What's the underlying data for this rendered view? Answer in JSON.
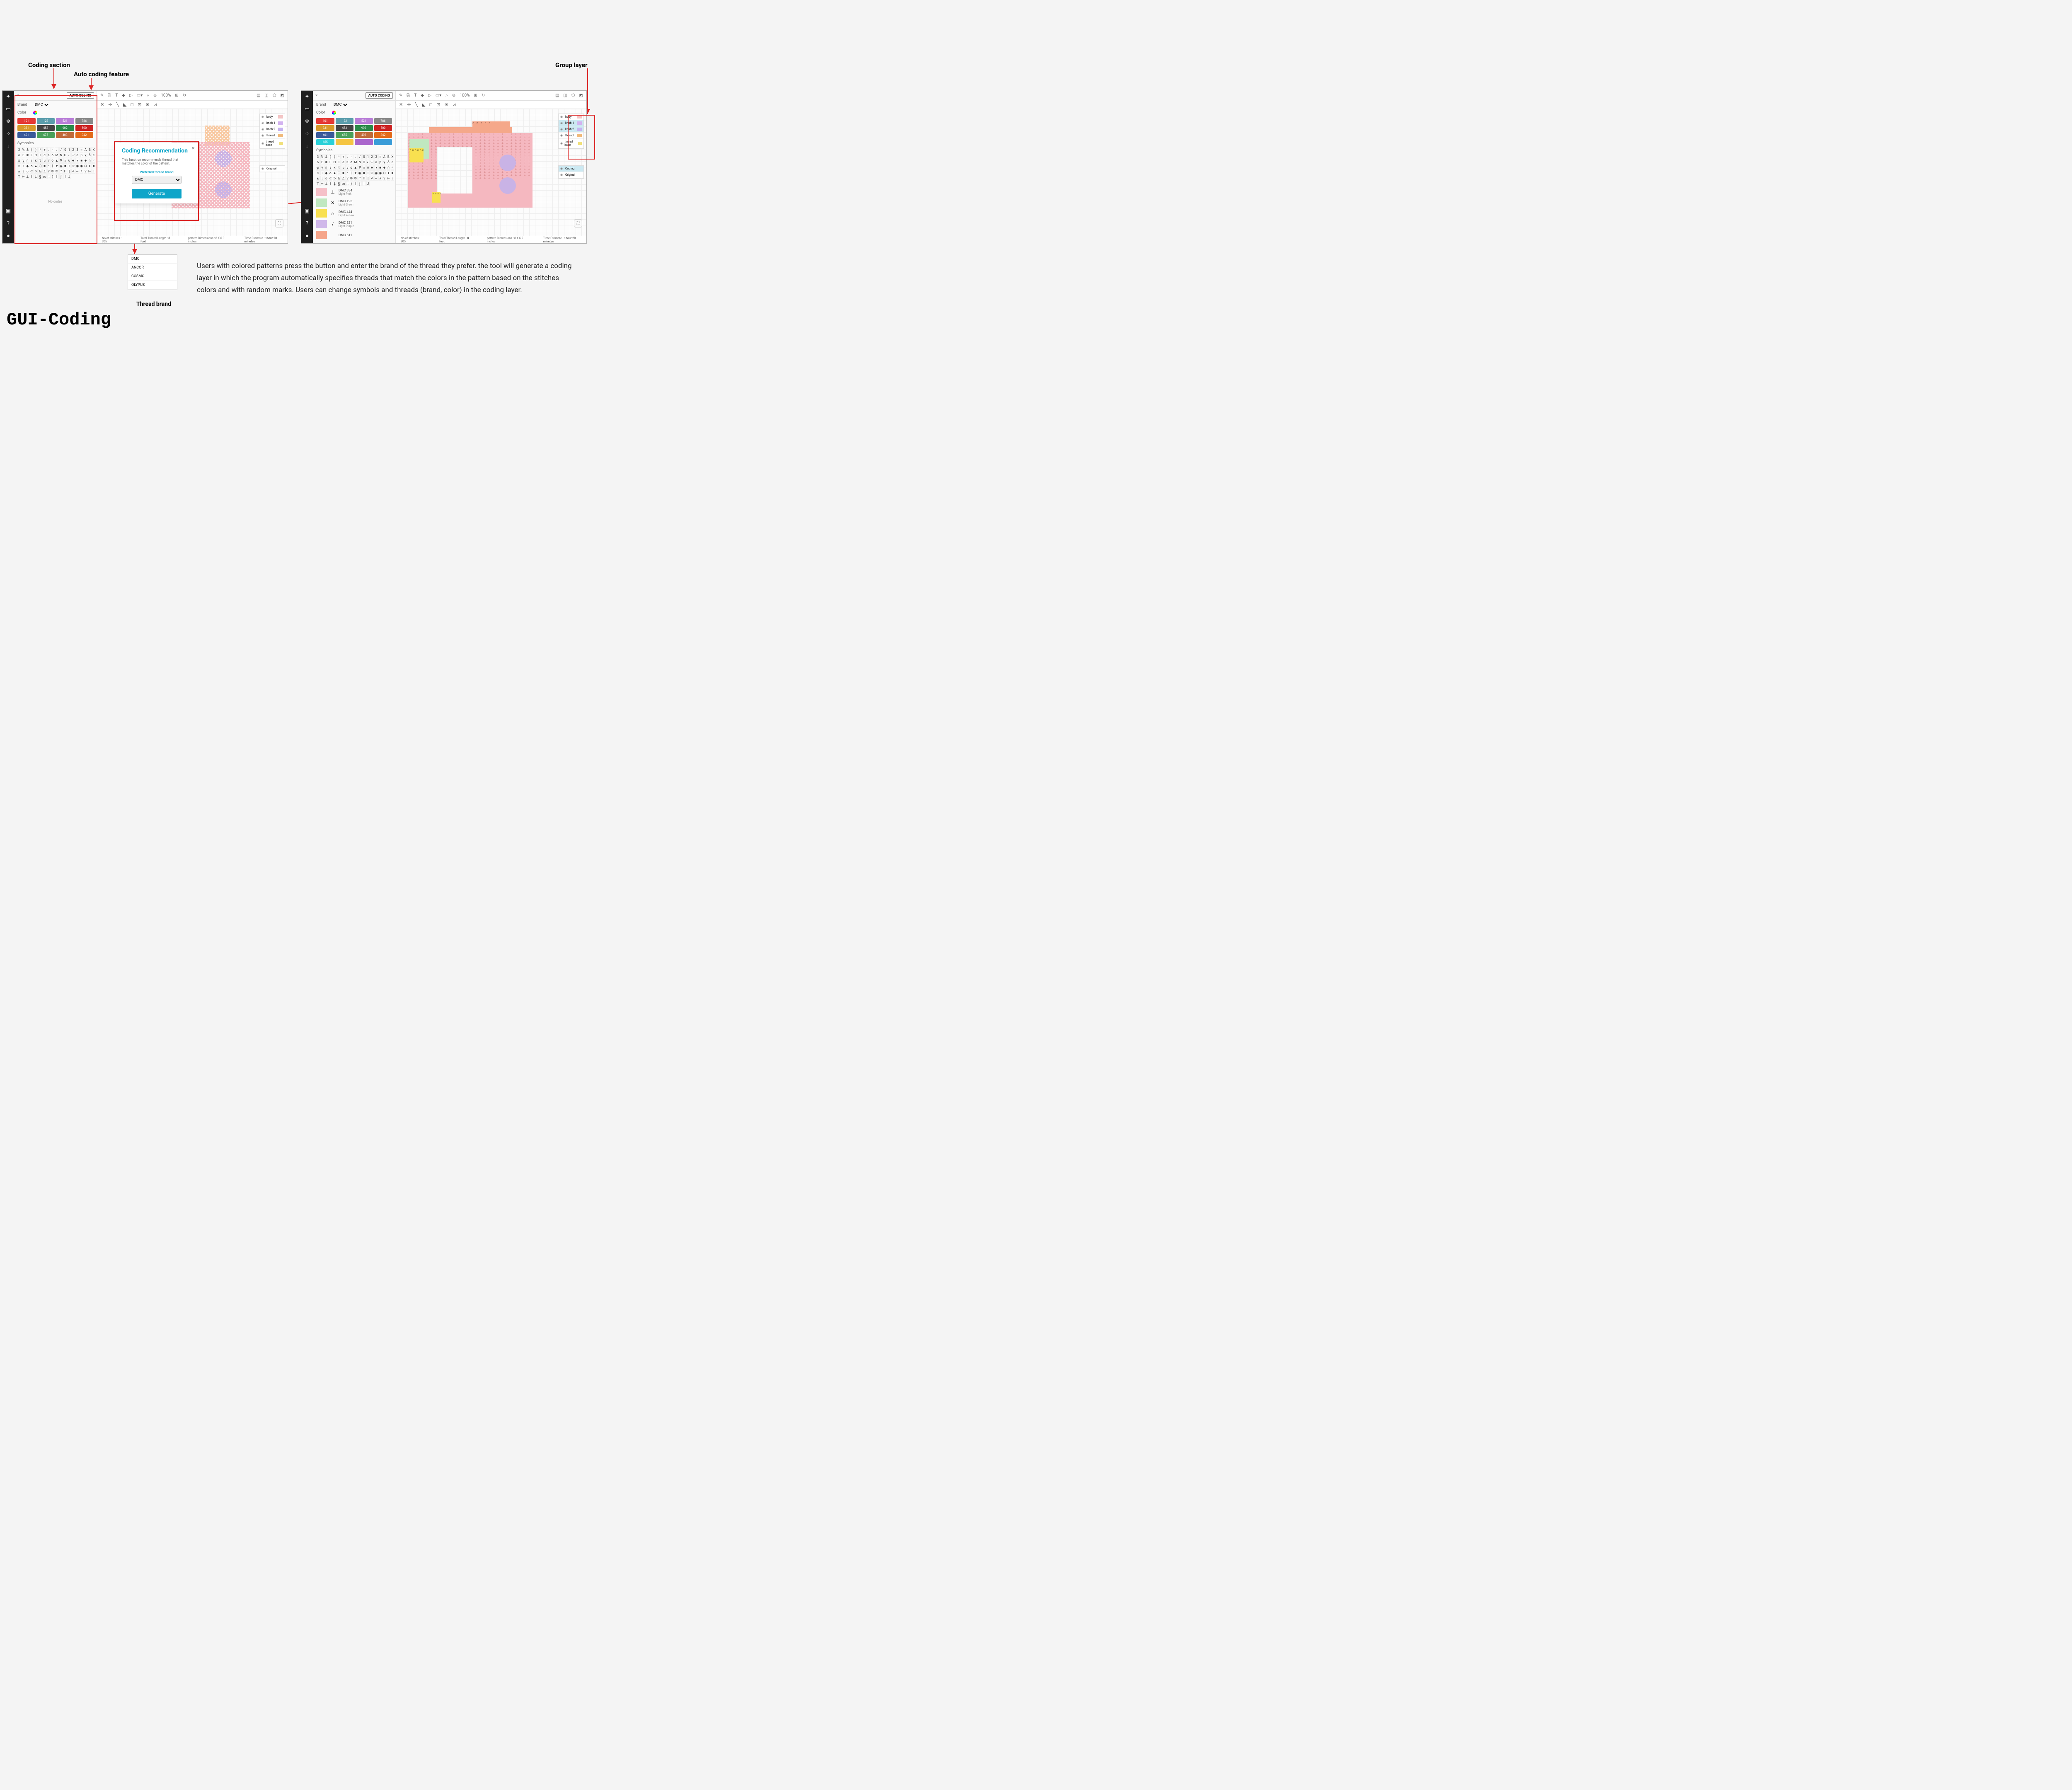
{
  "annotations": {
    "coding_section": "Coding section",
    "auto_coding_feature": "Auto coding feature",
    "group_layer": "Group layer",
    "thread_brand": "Thread brand"
  },
  "sidebar": {
    "auto_coding": "AUTO CODING",
    "brand_label": "Brand",
    "brand_value": "DMC",
    "color_label": "Color",
    "symbols_label": "Symboles",
    "no_codes": "No codes"
  },
  "swatches": [
    {
      "c": "#e53935",
      "t": "101"
    },
    {
      "c": "#5c9ead",
      "t": "122"
    },
    {
      "c": "#b97fd8",
      "t": "521"
    },
    {
      "c": "#888",
      "t": "786"
    },
    {
      "c": "#d89a2a",
      "t": "331"
    },
    {
      "c": "#444",
      "t": "453"
    },
    {
      "c": "#2a8a4a",
      "t": "902"
    },
    {
      "c": "#c22",
      "t": "500"
    },
    {
      "c": "#3b5a9a",
      "t": "401"
    },
    {
      "c": "#4aa05a",
      "t": "675"
    },
    {
      "c": "#c06a3a",
      "t": "403"
    },
    {
      "c": "#e36a1a",
      "t": "342"
    }
  ],
  "extra_swatches": [
    {
      "c": "#2ad0d8",
      "t": "655"
    },
    {
      "c": "#f5c542",
      "t": ""
    },
    {
      "c": "#aa66cc",
      "t": ""
    },
    {
      "c": "#3a9cd8",
      "t": ""
    }
  ],
  "symbols_rows": [
    "3 % & ( ) * + , - . / 0 1 2 3",
    "≡ A B X Δ E Φ Γ H I ϑ K Λ M N O",
    "◐ ♡ α β χ δ ε φ γ η ι κ τ μ ν ο",
    "▲ ∇ ☼ ∪ ♣ ◑ ■ ♣ ☆ ♂ ○ ◦ ◆ ✕ ▲ ⬡",
    "■ • | ♥ ◉ ■ + ☆ ◉ ◉ ⊡ ♦ ■ ▲ ↕",
    "∂ ⊂ ⊃ ∈ ∠ ∨ ® © ™ Π ∫ √ ∼ ∧ ∨",
    "⊢ ↑ ⊤ ⊨ ⊥ † ‡ § ∞ ∴ )  | ƒ |  J",
    ""
  ],
  "toolbar": {
    "zoom": "100%"
  },
  "modal": {
    "title": "Coding Recommendation",
    "desc": "This function recommends thread that matches the color of the pattern.",
    "pref_label": "Preferred thread brand",
    "brand": "DMC",
    "generate": "Generate"
  },
  "brand_options": [
    "DMC",
    "ANCOR",
    "COSMO",
    "OLYPUS"
  ],
  "layers_left": [
    {
      "name": "body",
      "c": "#f4c6c6"
    },
    {
      "name": "knob 1",
      "c": "#d3b3f0"
    },
    {
      "name": "knob 2",
      "c": "#c6b3f0"
    },
    {
      "name": "thread",
      "c": "#f0b97a"
    },
    {
      "name": "thread base",
      "c": "#f0e07a"
    }
  ],
  "layers_right": [
    {
      "name": "body",
      "c": "#f4c6c6"
    },
    {
      "name": "knob 1",
      "c": "#d3b3f0",
      "sel": true
    },
    {
      "name": "knob 2",
      "c": "#c6b3f0",
      "sel": true
    },
    {
      "name": "thread",
      "c": "#f0b97a"
    },
    {
      "name": "thread base",
      "c": "#f0e07a"
    }
  ],
  "layers_extra": [
    {
      "name": "Coding",
      "sel": true
    },
    {
      "name": "Original"
    }
  ],
  "layer_original": "Original",
  "threads": [
    {
      "c": "#f5c0c8",
      "sym": "⊥",
      "code": "DMC   334",
      "name": "Light Pink"
    },
    {
      "c": "#c0e8c0",
      "sym": "✕",
      "code": "DMC   125",
      "name": "Light Green"
    },
    {
      "c": "#f8e050",
      "sym": "∩",
      "code": "DMC   444",
      "name": "Light Yellow"
    },
    {
      "c": "#d0b8ea",
      "sym": "/",
      "code": "DMC   821",
      "name": "Light Purple"
    },
    {
      "c": "#f5a58a",
      "sym": "",
      "code": "DMC   511",
      "name": ""
    }
  ],
  "status": {
    "stitches_lbl": "No of stitches :",
    "stitches": "305",
    "length_lbl": "Total Thread Length :",
    "length": "8 foot",
    "dims_lbl": "pattern Dimensions :",
    "dims": "8 X 6.9 inches",
    "time_lbl": "Time Estimate :",
    "time": "1hour 20 minutes"
  },
  "description": "Users with colored patterns press the button and enter the brand of the thread they prefer. the tool will generate a coding layer in which the program automatically specifies threads that match the colors in the pattern  based on the stitches colors and with random marks. Users can change symbols and threads (brand, color) in the coding layer.",
  "title": "GUI-Coding"
}
